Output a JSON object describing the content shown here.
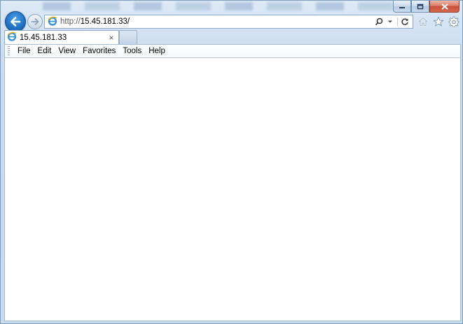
{
  "window": {
    "caption_buttons": {
      "minimize": "minimize-icon",
      "maximize": "restore-icon",
      "close": "close-icon"
    }
  },
  "navigation": {
    "back_icon": "back-arrow-icon",
    "forward_icon": "forward-arrow-icon"
  },
  "address_bar": {
    "url_scheme": "http://",
    "url_host": "15.45.181.33/",
    "search_icon": "search-icon",
    "dropdown_icon": "chevron-down-icon",
    "refresh_icon": "refresh-icon"
  },
  "toolbar_right": {
    "home_icon": "home-icon",
    "favorites_icon": "star-icon",
    "tools_icon": "gear-icon"
  },
  "tabs": [
    {
      "title": "15.45.181.33",
      "close": "×"
    }
  ],
  "menu": {
    "items": [
      "File",
      "Edit",
      "View",
      "Favorites",
      "Tools",
      "Help"
    ]
  },
  "colors": {
    "accent": "#1f6fc2",
    "frame": "#c9dcf1",
    "close_button": "#c8503a"
  }
}
